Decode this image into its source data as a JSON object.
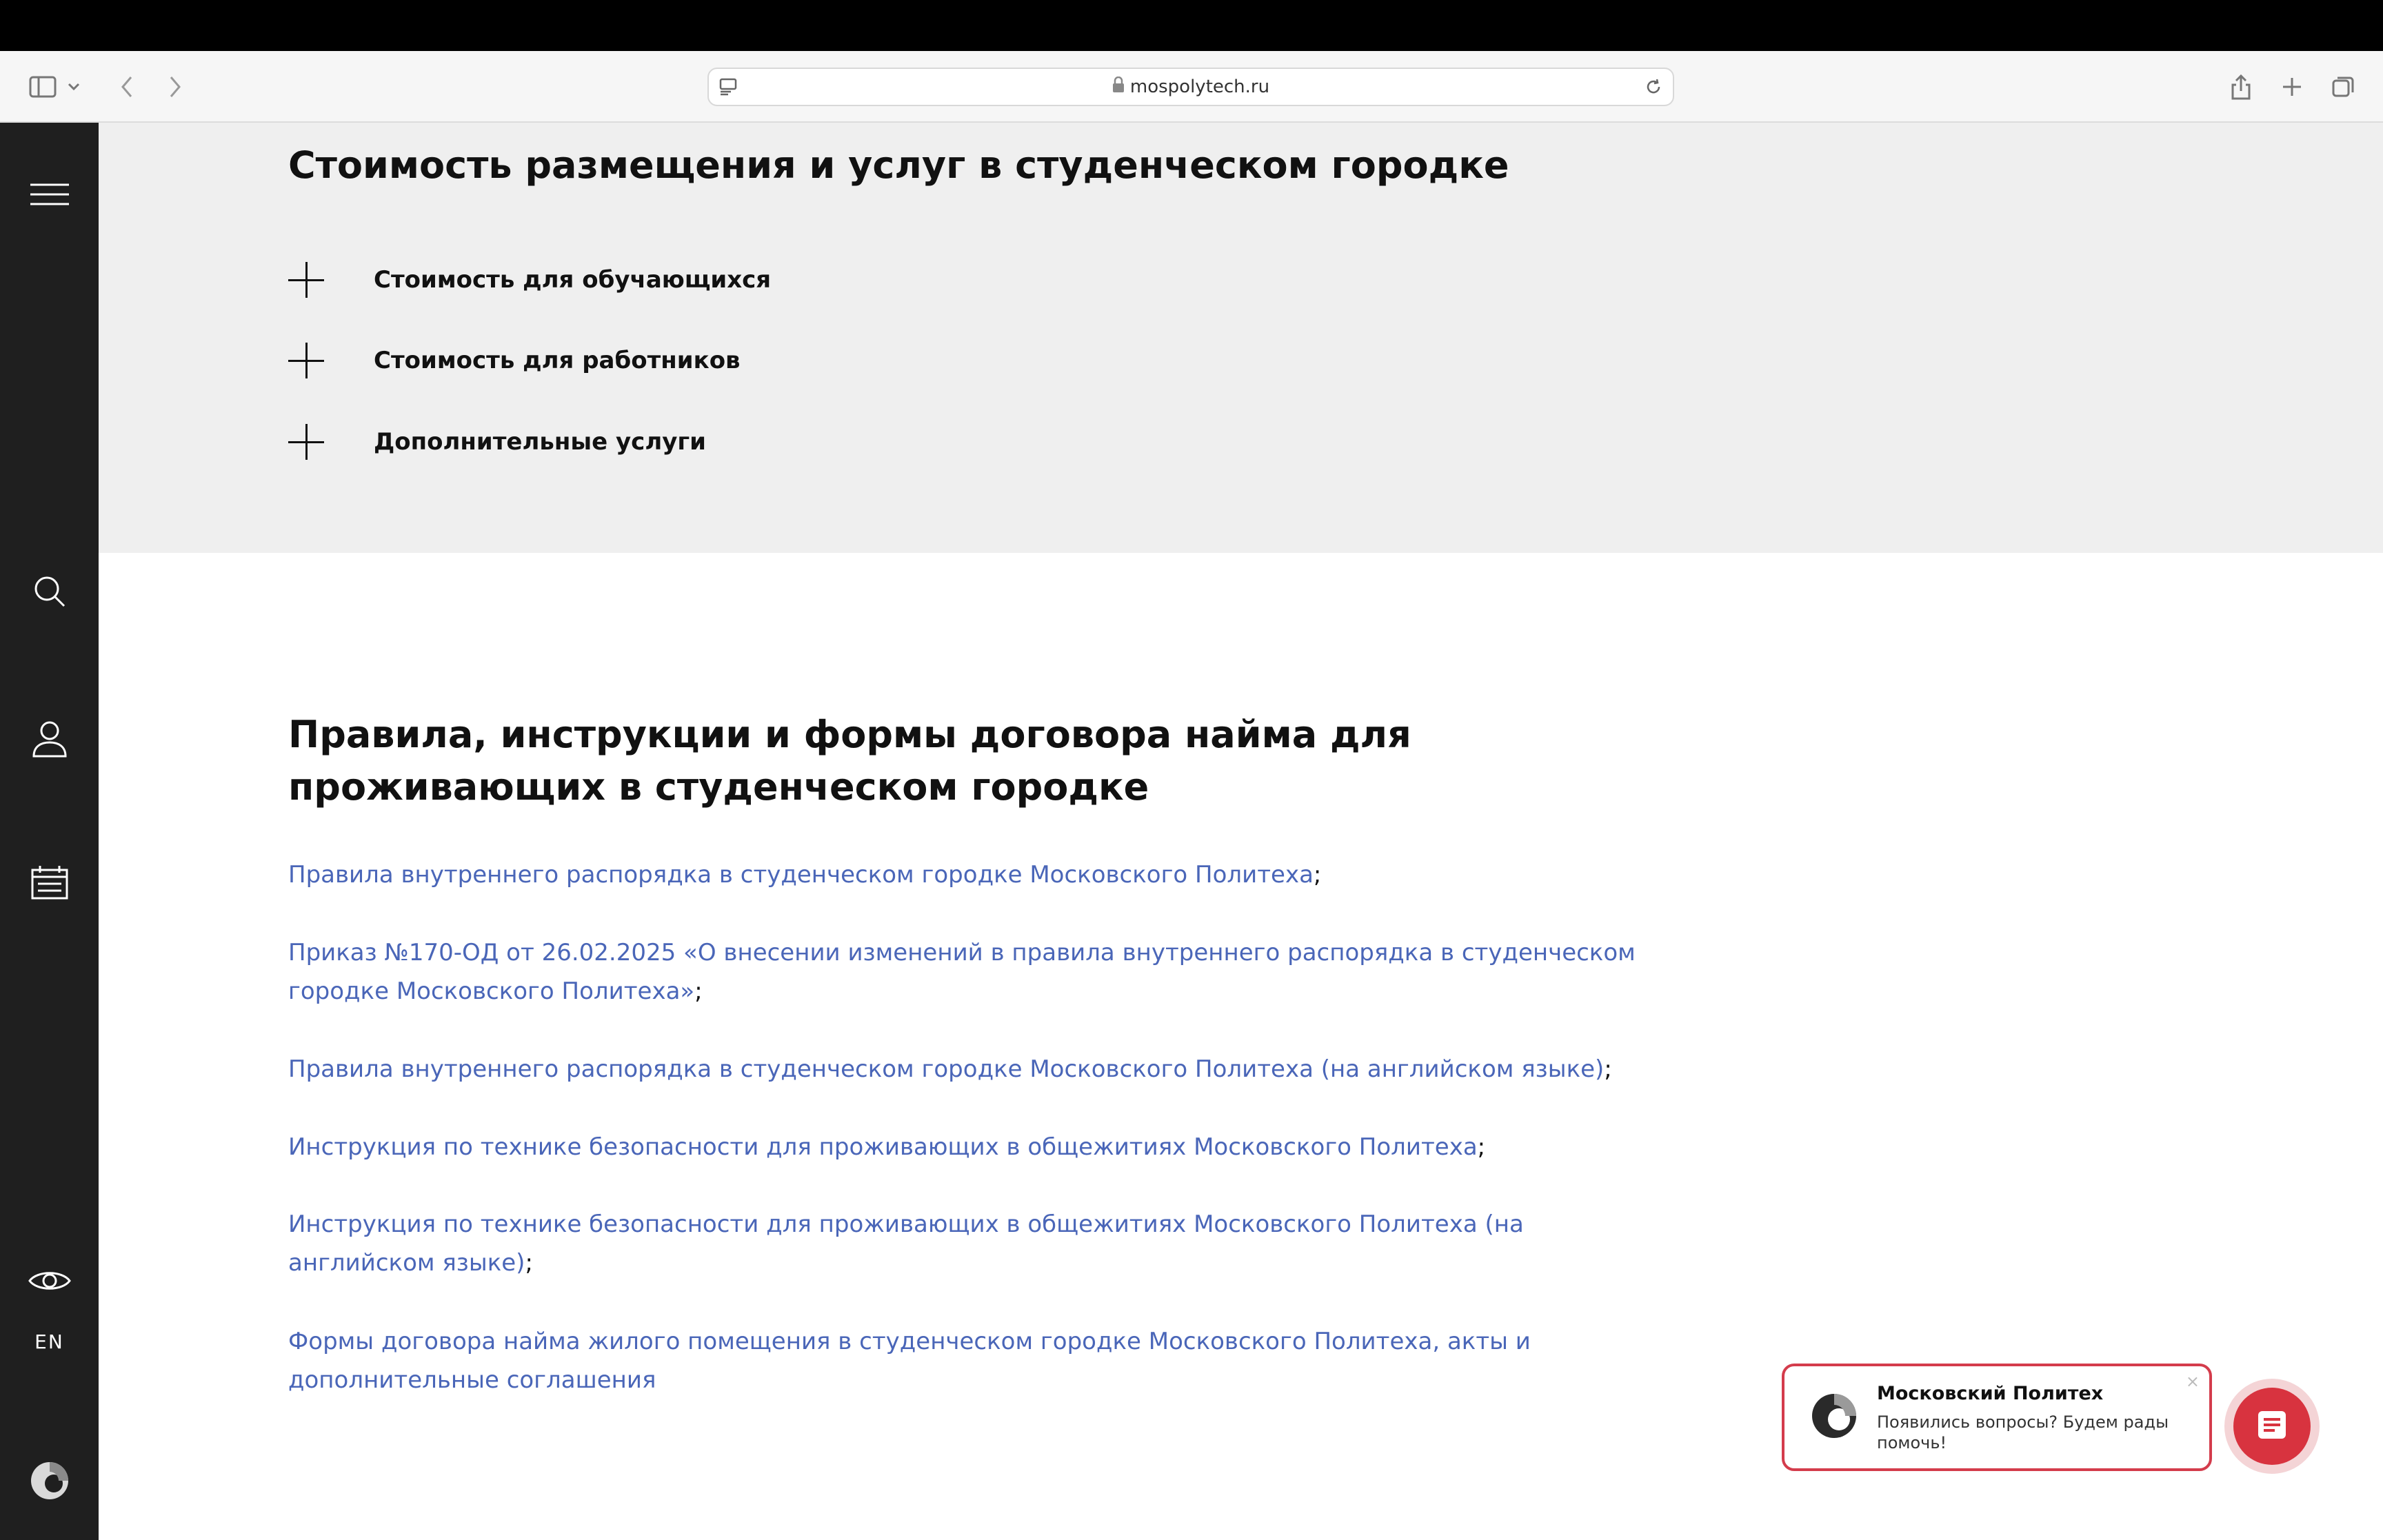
{
  "browser": {
    "url": "mospolytech.ru"
  },
  "sidebar": {
    "lang": "EN"
  },
  "costs": {
    "heading": "Стоимость размещения и услуг в студенческом городке",
    "items": [
      {
        "label": "Стоимость для обучающихся"
      },
      {
        "label": "Стоимость для работников"
      },
      {
        "label": "Дополнительные услуги"
      }
    ]
  },
  "rules": {
    "heading": "Правила, инструкции и формы договора найма для проживающих в студенческом городке",
    "links": [
      {
        "text": "Правила внутреннего распорядка в студенческом городке Московского Политеха",
        "suffix": ";"
      },
      {
        "text": "Приказ №170-ОД от 26.02.2025 «О внесении изменений в правила внутреннего распорядка в студенческом городке Московского Политеха»",
        "suffix": ";"
      },
      {
        "text": "Правила внутреннего распорядка в студенческом городке Московского Политеха (на английском языке)",
        "suffix": ";"
      },
      {
        "text": "Инструкция по технике безопасности для проживающих в общежитиях Московского Политеха",
        "suffix": ";"
      },
      {
        "text": "Инструкция по технике безопасности для проживающих в общежитиях Московского Политеха (на английском языке)",
        "suffix": ";"
      },
      {
        "text": "Формы договора найма жилого помещения в студенческом городке Московского Политеха, акты и дополнительные соглашения",
        "suffix": ""
      }
    ]
  },
  "chat": {
    "title": "Московский Политех",
    "message": "Появились вопросы? Будем рады помочь!",
    "close": "×"
  },
  "colors": {
    "link": "#4a66b8",
    "accent_red": "#d8333f",
    "sidebar_bg": "#1f1f1f",
    "section_bg": "#efefef"
  },
  "icons": {
    "browser": [
      "sidebar-toggle-icon",
      "chevron-down-icon",
      "back-icon",
      "forward-icon",
      "reader-icon",
      "lock-icon",
      "reload-icon",
      "share-icon",
      "new-tab-icon",
      "tabs-overview-icon"
    ],
    "sidebar": [
      "menu-icon",
      "search-icon",
      "user-icon",
      "calendar-icon",
      "eye-icon",
      "polytech-logo-icon"
    ],
    "chat": [
      "chat-icon"
    ]
  }
}
